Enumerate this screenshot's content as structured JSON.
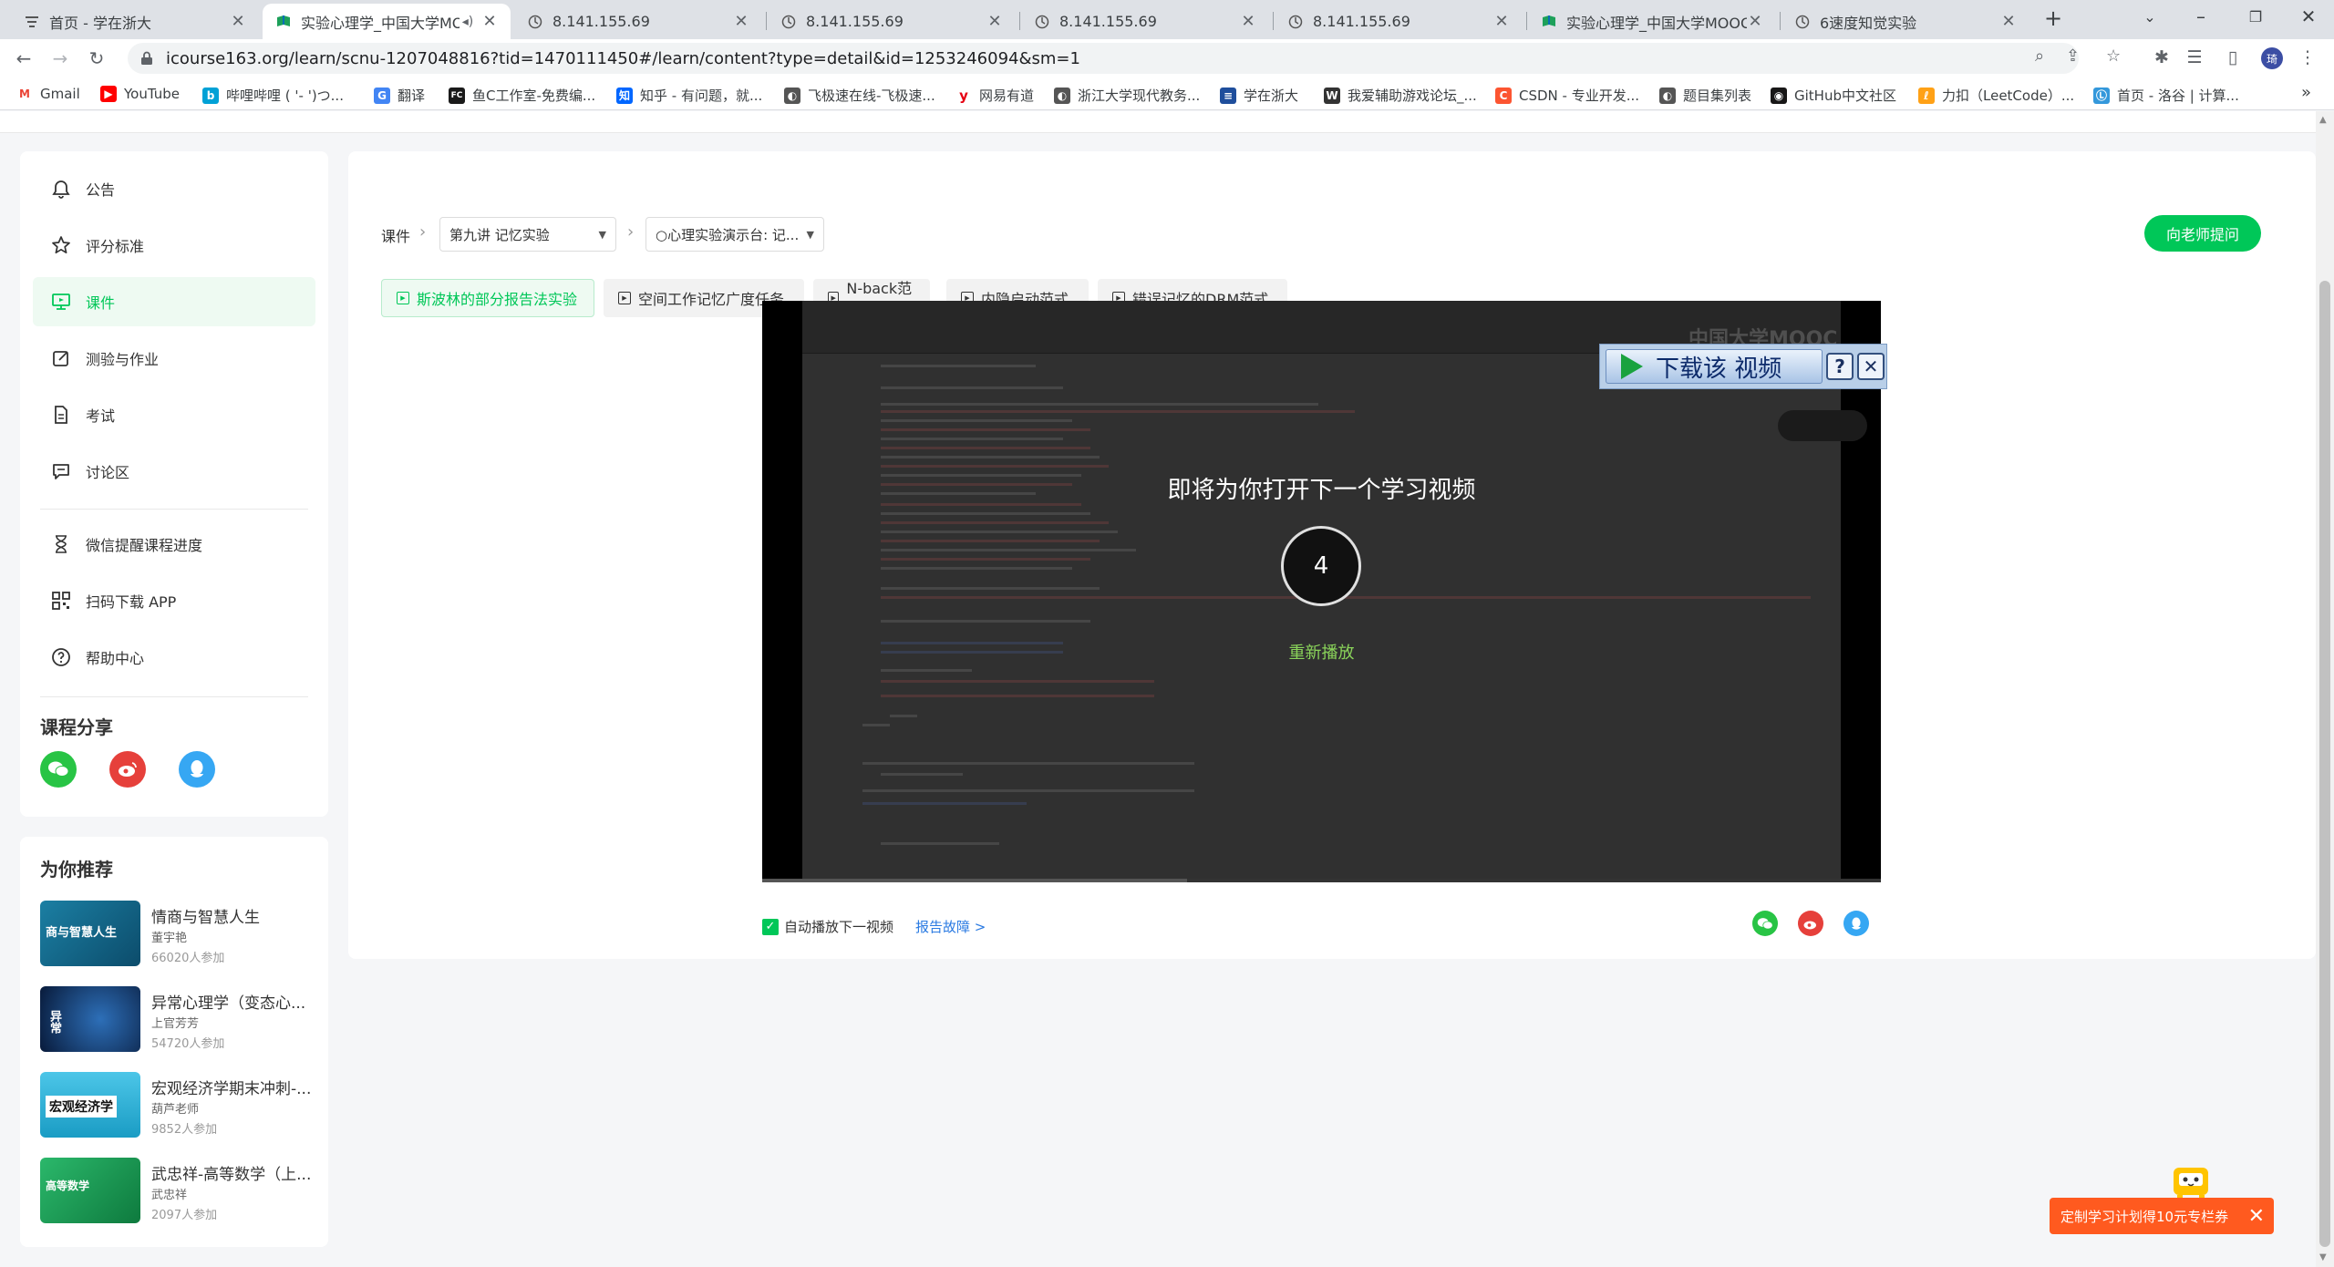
{
  "browser": {
    "tabs": [
      {
        "title": "首页 - 学在浙大",
        "favicon": "list-icon"
      },
      {
        "title": "实验心理学_中国大学MO",
        "favicon": "mooc-icon",
        "active": true
      },
      {
        "title": "8.141.155.69",
        "favicon": "globe-icon"
      },
      {
        "title": "8.141.155.69",
        "favicon": "globe-icon"
      },
      {
        "title": "8.141.155.69",
        "favicon": "globe-icon"
      },
      {
        "title": "8.141.155.69",
        "favicon": "globe-icon"
      },
      {
        "title": "实验心理学_中国大学MOOC",
        "favicon": "mooc-icon"
      },
      {
        "title": "6速度知觉实验",
        "favicon": "globe-icon"
      }
    ],
    "new_tab": "+",
    "url": "icourse163.org/learn/scnu-1207048816?tid=1470111450#/learn/content?type=detail&id=1253246094&sm=1",
    "profile_initial": "琦",
    "bookmarks": [
      {
        "label": "Gmail",
        "color": "#ea4335",
        "glyph": "M"
      },
      {
        "label": "YouTube",
        "color": "#ff0000",
        "glyph": "▶"
      },
      {
        "label": "哔哩哔哩 ( '- ')つ...",
        "color": "#00a1d6",
        "glyph": "b"
      },
      {
        "label": "翻译",
        "color": "#4285f4",
        "glyph": "G"
      },
      {
        "label": "鱼C工作室-免费编...",
        "color": "#1a1a1a",
        "glyph": "FC"
      },
      {
        "label": "知乎 - 有问题，就...",
        "color": "#0066ff",
        "glyph": "知"
      },
      {
        "label": "飞极速在线-飞极速...",
        "color": "#555555",
        "glyph": "◐"
      },
      {
        "label": "网易有道",
        "color": "#e60012",
        "glyph": "y"
      },
      {
        "label": "浙江大学现代教务...",
        "color": "#555555",
        "glyph": "◐"
      },
      {
        "label": "学在浙大",
        "color": "#1f4e9c",
        "glyph": "≡"
      },
      {
        "label": "我爱辅助游戏论坛_...",
        "color": "#333333",
        "glyph": "W"
      },
      {
        "label": "CSDN - 专业开发...",
        "color": "#fc5531",
        "glyph": "C"
      },
      {
        "label": "题目集列表",
        "color": "#555555",
        "glyph": "◐"
      },
      {
        "label": "GitHub中文社区",
        "color": "#181717",
        "glyph": "◉"
      },
      {
        "label": "力扣（LeetCode）...",
        "color": "#ffa116",
        "glyph": "ℓ"
      },
      {
        "label": "首页 - 洛谷 | 计算...",
        "color": "#3498db",
        "glyph": "Ⓛ"
      }
    ],
    "overflow": "»"
  },
  "sidebar": {
    "items": [
      {
        "label": "公告",
        "icon": "bell-icon"
      },
      {
        "label": "评分标准",
        "icon": "star-icon"
      },
      {
        "label": "课件",
        "icon": "courseware-icon",
        "active": true
      },
      {
        "label": "测验与作业",
        "icon": "edit-icon"
      },
      {
        "label": "考试",
        "icon": "exam-icon"
      },
      {
        "label": "讨论区",
        "icon": "chat-icon"
      }
    ],
    "extra_items": [
      {
        "label": "微信提醒课程进度",
        "icon": "hourglass-icon"
      },
      {
        "label": "扫码下载 APP",
        "icon": "qrcode-icon"
      },
      {
        "label": "帮助中心",
        "icon": "help-icon"
      }
    ],
    "share_title": "课程分享"
  },
  "recommend": {
    "title": "为你推荐",
    "items": [
      {
        "name": "情商与智慧人生",
        "teacher": "董宇艳",
        "count": "66020人参加",
        "thumb_text": "商与智慧人生",
        "thumb_color": "#1b7fa3"
      },
      {
        "name": "异常心理学（变态心...",
        "teacher": "上官芳芳",
        "count": "54720人参加",
        "thumb_text": "异常",
        "thumb_color": "#0d2a55"
      },
      {
        "name": "宏观经济学期末冲刺-...",
        "teacher": "葫芦老师",
        "count": "9852人参加",
        "thumb_text": "宏观经济学",
        "thumb_color": "#27b3d6"
      },
      {
        "name": "武忠祥-高等数学（上...",
        "teacher": "武忠祥",
        "count": "2097人参加",
        "thumb_text": "高等数学",
        "thumb_color": "#1ea05a"
      }
    ]
  },
  "main": {
    "breadcrumb_root": "课件",
    "chapter_select": "第九讲 记忆实验",
    "lesson_select": "○心理实验演示台: 记...",
    "ask_button": "向老师提问",
    "tabs": [
      {
        "label": "斯波林的部分报告法实验",
        "active": true
      },
      {
        "label": "空间工作记忆广度任务"
      },
      {
        "label": "N-back范式"
      },
      {
        "label": "内隐启动范式"
      },
      {
        "label": "错误记忆的DRM范式"
      }
    ],
    "video": {
      "message": "即将为你打开下一个学习视频",
      "countdown": "4",
      "replay": "重新播放",
      "logo": "中国大学MOOC",
      "progress": 0.38,
      "download_label": "下载该 视频",
      "download_help": "?",
      "download_close": "✕"
    },
    "autoplay_label": "自动播放下一视频",
    "report_label": "报告故障 >"
  },
  "coupon": {
    "label": "定制学习计划得10元专栏券",
    "close": "✕"
  },
  "colors": {
    "accent": "#00c758",
    "link": "#2a7ae2",
    "coupon": "#ff5a1f"
  }
}
